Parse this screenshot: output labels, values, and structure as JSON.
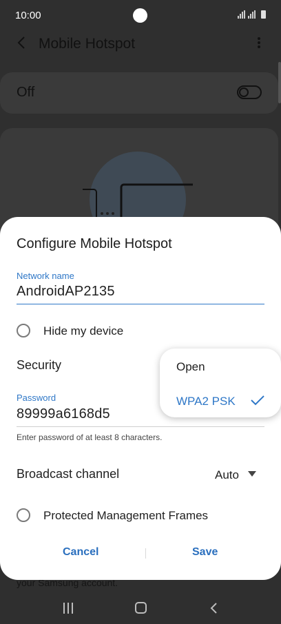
{
  "status_bar": {
    "time": "10:00"
  },
  "header": {
    "title": "Mobile Hotspot"
  },
  "background": {
    "toggle_label": "Off",
    "footer_text": "your Samsung account."
  },
  "dialog": {
    "title": "Configure Mobile Hotspot",
    "network_name": {
      "label": "Network name",
      "value": "AndroidAP2135"
    },
    "hide_device": {
      "label": "Hide my device",
      "checked": false
    },
    "security": {
      "label": "Security",
      "selected": "WPA2 PSK"
    },
    "password": {
      "label": "Password",
      "value": "89999a6168d5",
      "hint": "Enter password of at least 8 characters."
    },
    "broadcast_channel": {
      "label": "Broadcast channel",
      "value": "Auto"
    },
    "pmf": {
      "label": "Protected Management Frames",
      "checked": false
    },
    "buttons": {
      "cancel": "Cancel",
      "save": "Save"
    }
  },
  "security_popup": {
    "options": [
      {
        "label": "Open",
        "selected": false
      },
      {
        "label": "WPA2 PSK",
        "selected": true
      }
    ]
  },
  "colors": {
    "accent": "#2e77c7",
    "dim_overlay": "#2f2f2f",
    "dialog_bg": "#ffffff"
  },
  "icons": [
    "back-icon",
    "more-icon",
    "switch-icon",
    "radio-icon",
    "caret-down-icon",
    "check-icon",
    "nav-recent-icon",
    "nav-home-icon",
    "nav-back-icon"
  ]
}
